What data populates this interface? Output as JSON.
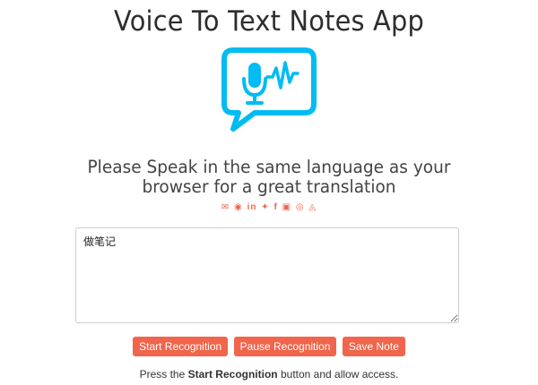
{
  "app": {
    "title": "Voice To Text Notes App",
    "accent_color": "#f0654b",
    "logo_color": "#00bcf2",
    "logo_icon": "microphone-speech-bubble-icon"
  },
  "subtitle": {
    "line1": "Please Speak in the same language as your",
    "line2": "browser for a great translation"
  },
  "social": [
    {
      "icon": "email-icon",
      "glyph": "✉"
    },
    {
      "icon": "github-icon",
      "glyph": "◉"
    },
    {
      "icon": "linkedin-icon",
      "glyph": "in"
    },
    {
      "icon": "twitter-icon",
      "glyph": "✦"
    },
    {
      "icon": "facebook-icon",
      "glyph": "f"
    },
    {
      "icon": "youtube-icon",
      "glyph": "▣"
    },
    {
      "icon": "instagram-icon",
      "glyph": "◎"
    },
    {
      "icon": "other-social-icon",
      "glyph": "◬"
    }
  ],
  "note": {
    "value": "做笔记"
  },
  "buttons": {
    "start": "Start Recognition",
    "pause": "Pause Recognition",
    "save": "Save Note"
  },
  "instructions": {
    "prefix": "Press the ",
    "bold": "Start Recognition",
    "suffix": " button and allow access."
  }
}
